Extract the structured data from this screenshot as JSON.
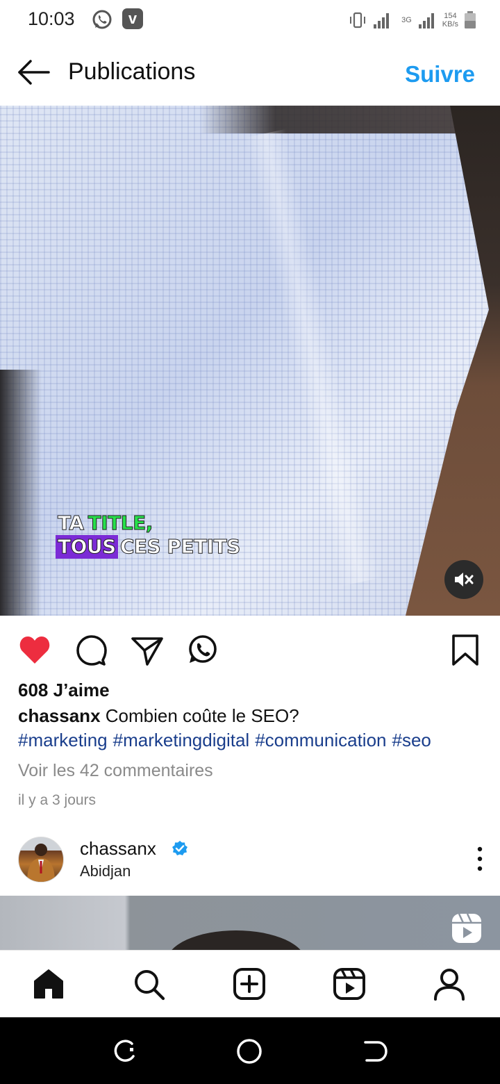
{
  "status_bar": {
    "time": "10:03",
    "network_type": "3G",
    "speed_value": "154",
    "speed_unit": "KB/s",
    "icons": [
      "whatsapp-icon",
      "v-app-icon",
      "vibrate-icon",
      "signal-icon",
      "signal-icon-2",
      "battery-icon"
    ]
  },
  "header": {
    "title": "Publications",
    "follow_label": "Suivre"
  },
  "media": {
    "caption_line1_a": "TA",
    "caption_line1_b": "TITLE,",
    "caption_line2_a": "TOUS",
    "caption_line2_b": "CES PETITS"
  },
  "post": {
    "likes": "608 J’aime",
    "username": "chassanx",
    "caption": "Combien coûte le SEO?",
    "hashtags": [
      "#marketing",
      "#marketingdigital",
      "#communication",
      "#seo"
    ],
    "comments_link": "Voir les 42 commentaires",
    "timestamp": "il y a 3 jours",
    "liked": true
  },
  "next_post": {
    "username": "chassanx",
    "location": "Abidjan",
    "verified": true
  },
  "colors": {
    "accent": "#1d9bf0",
    "like": "#ed2d3f",
    "hashtag": "#1a3e8c",
    "muted_text": "#8a8a8a"
  }
}
